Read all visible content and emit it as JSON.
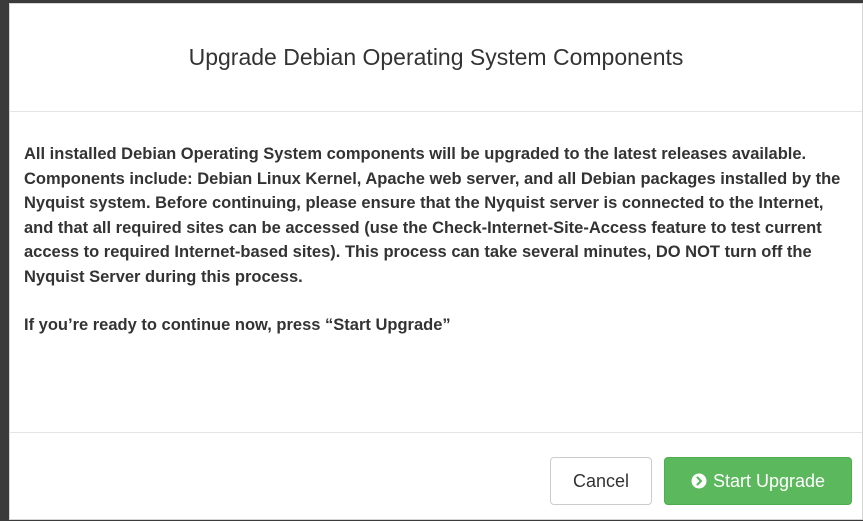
{
  "modal": {
    "title": "Upgrade Debian Operating System Components",
    "body_paragraph": "All installed Debian Operating System components will be upgraded to the latest releases available. Components include: Debian Linux Kernel, Apache web server, and all Debian packages installed by the Nyquist system. Before continuing, please ensure that the Nyquist server is connected to the Internet, and that all required sites can be accessed (use the Check-Internet-Site-Access feature to test current access to required Internet-based sites). This process can take several minutes, DO NOT turn off the Nyquist Server during this process.",
    "prompt": "If you’re ready to continue now, press “Start Upgrade”"
  },
  "footer": {
    "cancel_label": "Cancel",
    "start_label": "Start Upgrade",
    "start_icon": "circle-chevron-right-icon"
  },
  "colors": {
    "primary_success": "#5cb85c",
    "text": "#333333"
  }
}
